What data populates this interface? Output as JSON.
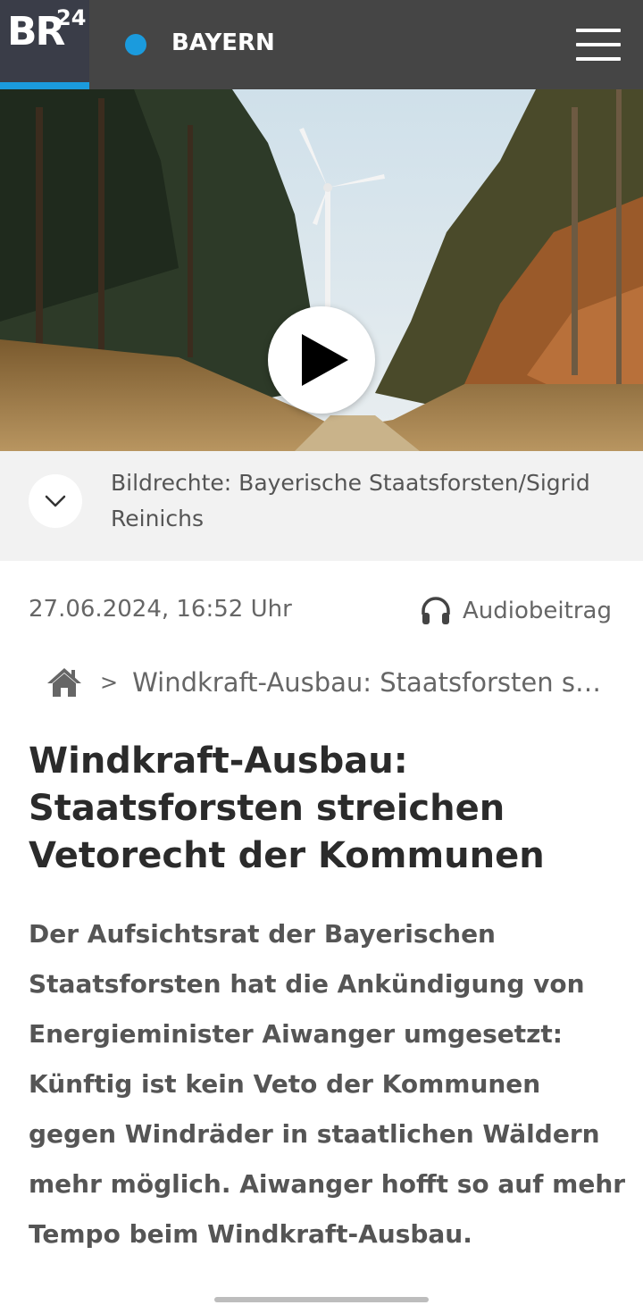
{
  "header": {
    "logo_text": "BR",
    "logo_number": "24",
    "region": "BAYERN",
    "accent_color": "#1b9bdd",
    "menu_icon": "hamburger-menu-icon"
  },
  "media": {
    "play_icon": "play-icon"
  },
  "credit": {
    "text": "Bildrechte: Bayerische Staatsforsten/Sigrid Reinichs",
    "toggle_icon": "chevron-down-icon"
  },
  "meta": {
    "datetime": "27.06.2024, 16:52 Uhr",
    "audio_label": "Audiobeitrag",
    "audio_icon": "headphones-icon"
  },
  "breadcrumb": {
    "home_icon": "home-icon",
    "separator": ">",
    "current": "Windkraft-Ausbau: Staatsforsten streichen Vetorecht der Kommunen"
  },
  "article": {
    "headline": "Windkraft-Ausbau: Staatsforsten streichen Vetorecht der Kommunen",
    "teaser": "Der Aufsichtsrat der Bayerischen Staatsforsten hat die Ankündigung von Energieminister Aiwanger umgesetzt: Künftig ist kein Veto der Kommunen gegen Windräder in staatlichen Wäldern mehr möglich. Aiwanger hofft so auf mehr Tempo beim Windkraft-Ausbau."
  }
}
